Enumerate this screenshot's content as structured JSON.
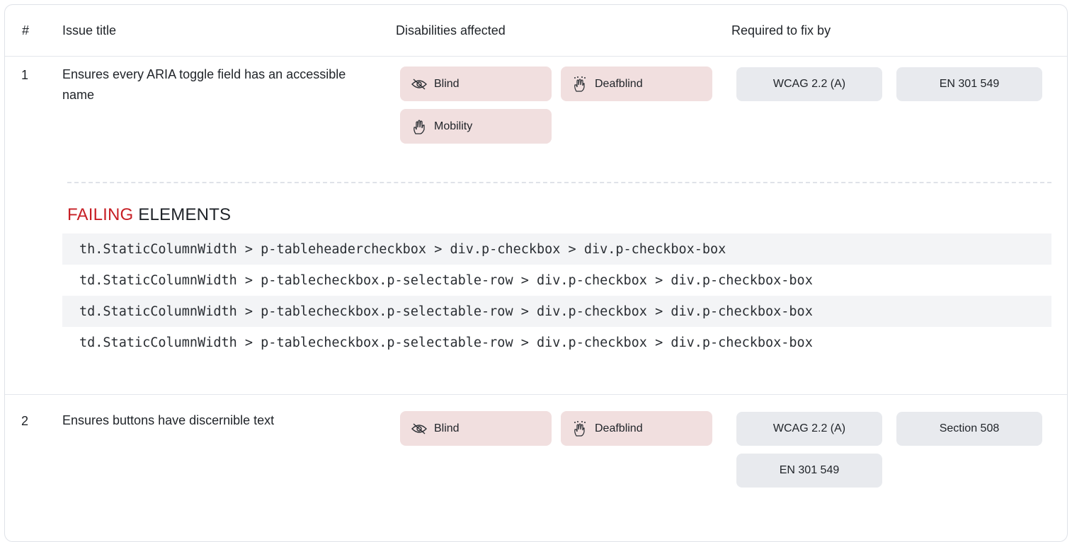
{
  "table": {
    "headers": {
      "num": "#",
      "title": "Issue title",
      "disabilities": "Disabilities affected",
      "required": "Required to fix by"
    },
    "rows": [
      {
        "num": "1",
        "title": "Ensures every ARIA toggle field has an accessible name",
        "disabilities": [
          {
            "label": "Blind",
            "icon": "eye-slash-icon"
          },
          {
            "label": "Deafblind",
            "icon": "braille-hand-icon"
          },
          {
            "label": "Mobility",
            "icon": "hand-icon"
          }
        ],
        "standards": [
          "WCAG 2.2 (A)",
          "EN 301 549"
        ],
        "failing": {
          "label_highlight": "FAILING",
          "label_rest": " ELEMENTS",
          "selectors": [
            "th.StaticColumnWidth > p-tableheadercheckbox > div.p-checkbox > div.p-checkbox-box",
            "td.StaticColumnWidth > p-tablecheckbox.p-selectable-row > div.p-checkbox > div.p-checkbox-box",
            "td.StaticColumnWidth > p-tablecheckbox.p-selectable-row > div.p-checkbox > div.p-checkbox-box",
            "td.StaticColumnWidth > p-tablecheckbox.p-selectable-row > div.p-checkbox > div.p-checkbox-box"
          ]
        }
      },
      {
        "num": "2",
        "title": "Ensures buttons have discernible text",
        "disabilities": [
          {
            "label": "Blind",
            "icon": "eye-slash-icon"
          },
          {
            "label": "Deafblind",
            "icon": "braille-hand-icon"
          }
        ],
        "standards": [
          "WCAG 2.2 (A)",
          "Section 508",
          "EN 301 549"
        ]
      }
    ]
  },
  "colors": {
    "disability_pill_bg": "#f1dfdf",
    "standard_pill_bg": "#e8eaee",
    "failing_accent": "#c71f25"
  }
}
